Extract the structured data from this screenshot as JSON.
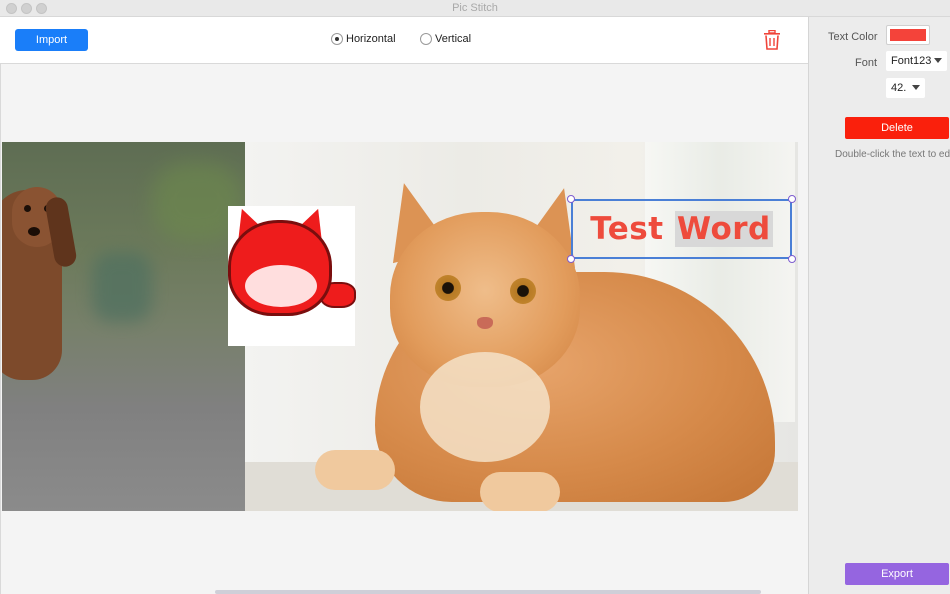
{
  "window": {
    "title": "Pic Stitch"
  },
  "toolbar": {
    "import_label": "Import",
    "layout_options": [
      {
        "label": "Horizontal",
        "selected": true
      },
      {
        "label": "Vertical",
        "selected": false
      }
    ],
    "trash_icon": "trash-icon",
    "trash_color": "#f0453a"
  },
  "canvas": {
    "images": [
      "dog-photo",
      "cat-photo"
    ],
    "sticker": "red-fox-sticker",
    "text_overlay": {
      "text_part1": "Test ",
      "text_part2": "Word",
      "color": "#ee4b3c"
    }
  },
  "right_panel": {
    "text_color_label": "Text Color",
    "text_color_value": "#f4433a",
    "font_label": "Font",
    "font_value": "Font123",
    "size_value": "42.",
    "delete_label": "Delete",
    "hint": "Double-click the text to ed",
    "export_label": "Export"
  },
  "colors": {
    "import_button": "#1a7ef9",
    "delete_button": "#fa200c",
    "export_button": "#9565e0",
    "selection_border": "#4a7fd6"
  }
}
